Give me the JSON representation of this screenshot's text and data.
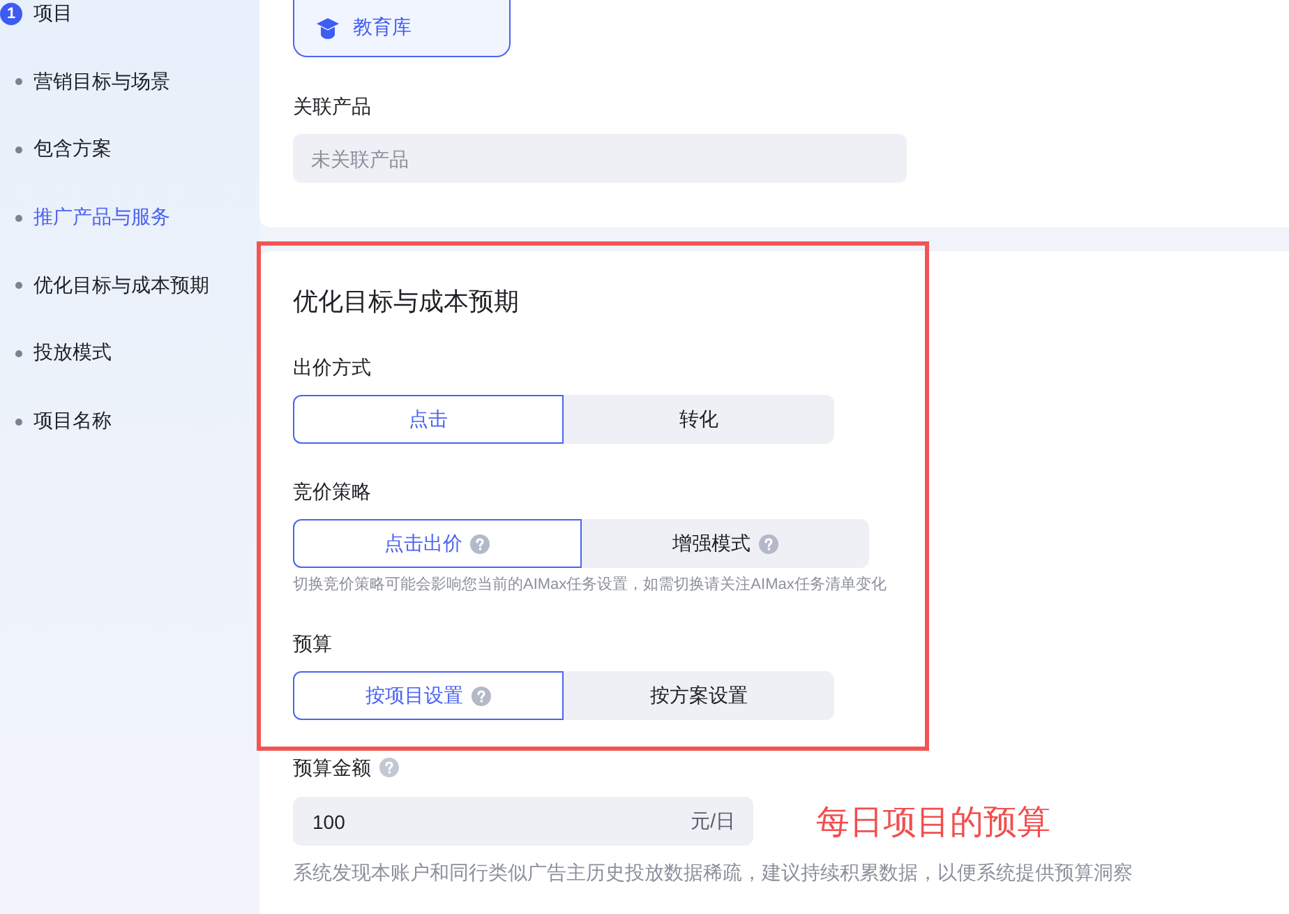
{
  "sidebar": {
    "items": [
      {
        "kind": "step",
        "marker": "1",
        "label": "项目",
        "selected": false
      },
      {
        "kind": "section",
        "label": "营销目标与场景",
        "selected": false
      },
      {
        "kind": "section",
        "label": "包含方案",
        "selected": false
      },
      {
        "kind": "section",
        "label": "推广产品与服务",
        "selected": true
      },
      {
        "kind": "section",
        "label": "优化目标与成本预期",
        "selected": false
      },
      {
        "kind": "section",
        "label": "投放模式",
        "selected": false
      },
      {
        "kind": "section",
        "label": "项目名称",
        "selected": false
      }
    ]
  },
  "product_card": {
    "library_tile": {
      "label": "教育库",
      "selected": true
    },
    "related_product": {
      "label": "关联产品",
      "placeholder": "未关联产品"
    }
  },
  "optimization": {
    "title": "优化目标与成本预期",
    "groups": [
      {
        "label": "出价方式",
        "options": [
          {
            "label": "点击",
            "help": false,
            "selected": true
          },
          {
            "label": "转化",
            "help": false,
            "selected": false
          }
        ]
      },
      {
        "label": "竞价策略",
        "options": [
          {
            "label": "点击出价",
            "help": true,
            "selected": true
          },
          {
            "label": "增强模式",
            "help": true,
            "selected": false
          }
        ],
        "hint": "切换竞价策略可能会影响您当前的AIMax任务设置，如需切换请关注AIMax任务清单变化"
      },
      {
        "label": "预算",
        "options": [
          {
            "label": "按项目设置",
            "help": true,
            "selected": true
          },
          {
            "label": "按方案设置",
            "help": false,
            "selected": false
          }
        ]
      }
    ]
  },
  "budget_amount": {
    "label": "预算金额",
    "help": true,
    "value": "100",
    "unit": "元/日",
    "hint": "系统发现本账户和同行类似广告主历史投放数据稀疏，建议持续积累数据，以便系统提供预算洞察"
  },
  "annotation": {
    "text": "每日项目的预算"
  }
}
